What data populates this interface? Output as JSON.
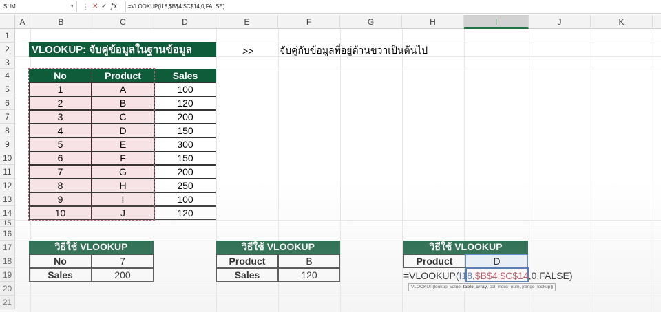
{
  "formula_bar": {
    "name_box": "SUM",
    "formula": "=VLOOKUP(I18,$B$4:$C$14,0,FALSE)"
  },
  "icons": {
    "cancel": "x-icon",
    "enter": "check-icon",
    "function": "fx-icon"
  },
  "columns": [
    "A",
    "B",
    "C",
    "D",
    "E",
    "F",
    "G",
    "H",
    "I",
    "J",
    "K"
  ],
  "rows": [
    "1",
    "2",
    "3",
    "4",
    "5",
    "6",
    "7",
    "8",
    "9",
    "10",
    "11",
    "12",
    "13",
    "14",
    "15",
    "16",
    "17",
    "18",
    "19",
    "20",
    "21"
  ],
  "banner": "VLOOKUP: จับคู่ข้อมูลในฐานข้อมูล",
  "note_arrow": ">>",
  "note_text": "จับคู่กับข้อมูลที่อยู่ด้านขวาเป็นต้นไป",
  "table": {
    "headers": [
      "No",
      "Product",
      "Sales"
    ],
    "rows": [
      [
        "1",
        "A",
        "100"
      ],
      [
        "2",
        "B",
        "120"
      ],
      [
        "3",
        "C",
        "200"
      ],
      [
        "4",
        "D",
        "150"
      ],
      [
        "5",
        "E",
        "300"
      ],
      [
        "6",
        "F",
        "150"
      ],
      [
        "7",
        "G",
        "200"
      ],
      [
        "8",
        "H",
        "250"
      ],
      [
        "9",
        "I",
        "100"
      ],
      [
        "10",
        "J",
        "120"
      ]
    ]
  },
  "box1": {
    "title": "วิธีใช้ VLOOKUP",
    "label1": "No",
    "value1": "7",
    "label2": "Sales",
    "value2": "200"
  },
  "box2": {
    "title": "วิธีใช้ VLOOKUP",
    "label1": "Product",
    "value1": "B",
    "label2": "Sales",
    "value2": "120"
  },
  "box3": {
    "title": "วิธีใช้ VLOOKUP",
    "label1": "Product",
    "value1": "D",
    "formula_parts": {
      "prefix": "=VLOOKUP(",
      "ref1": "I18",
      "comma1": ",",
      "ref2": "$B$4:$C$14",
      "suffix": ",0,FALSE)"
    },
    "tooltip": {
      "start": "VLOOKUP(lookup_value, ",
      "bold": "table_array",
      "end": ", col_index_num, [range_lookup])"
    }
  },
  "colors": {
    "header_green": "#0f5c3a",
    "pink_fill": "#f7e3e6",
    "ref_blue": "#2f5fa8",
    "ref_red": "#b03545",
    "selected_col": "#217346"
  }
}
